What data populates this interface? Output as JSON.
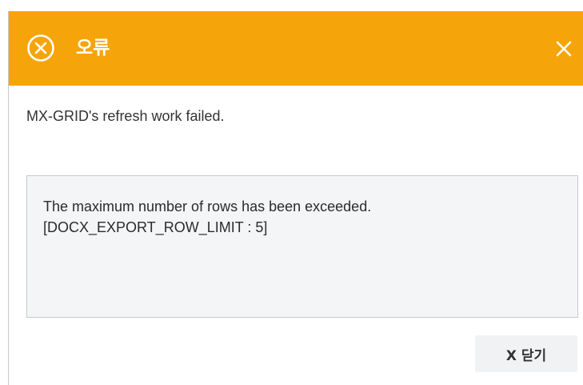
{
  "dialog": {
    "title": "오류",
    "title_icon": "error-circle-x-icon",
    "close_icon": "close-icon",
    "accent_color": "#f5a50a",
    "message": "MX-GRID's refresh work failed.",
    "detail_lines": [
      "The maximum number of rows has been exceeded.",
      "[DOCX_EXPORT_ROW_LIMIT : 5]"
    ],
    "close_button_label": "X 닫기"
  }
}
